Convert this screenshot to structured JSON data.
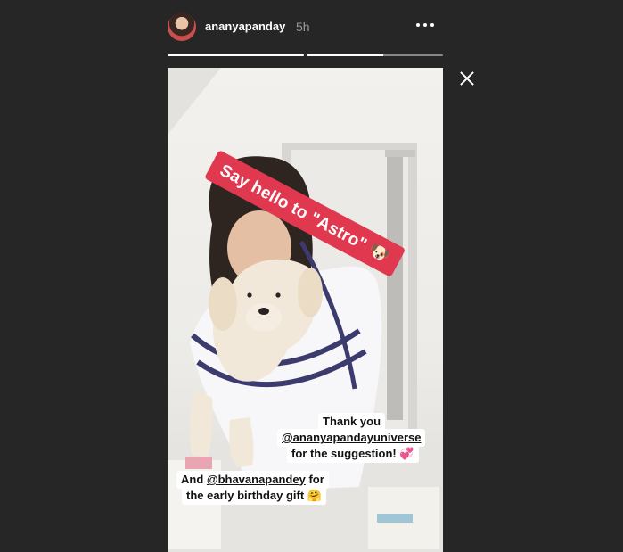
{
  "story": {
    "username": "ananyapanday",
    "time": "5h",
    "progress": [
      1.0,
      0.56,
      0.0
    ]
  },
  "stickers": {
    "title": "Say hello to \"Astro\" 🐶",
    "thanks_line1": "Thank you",
    "thanks_line2": "@ananyapandayuniverse",
    "thanks_line3": "for the suggestion! 💞",
    "gift_prefix": "And ",
    "gift_mention": "@bhavanapandey",
    "gift_suffix": " for",
    "gift_line2": "the early birthday gift 🤗"
  },
  "icons": {
    "avatar": "profile-avatar",
    "more": "more-options-icon",
    "close": "close-icon"
  },
  "colors": {
    "background": "#262626",
    "sticker_red": "#e0394f",
    "caption_bg": "#ffffff"
  }
}
